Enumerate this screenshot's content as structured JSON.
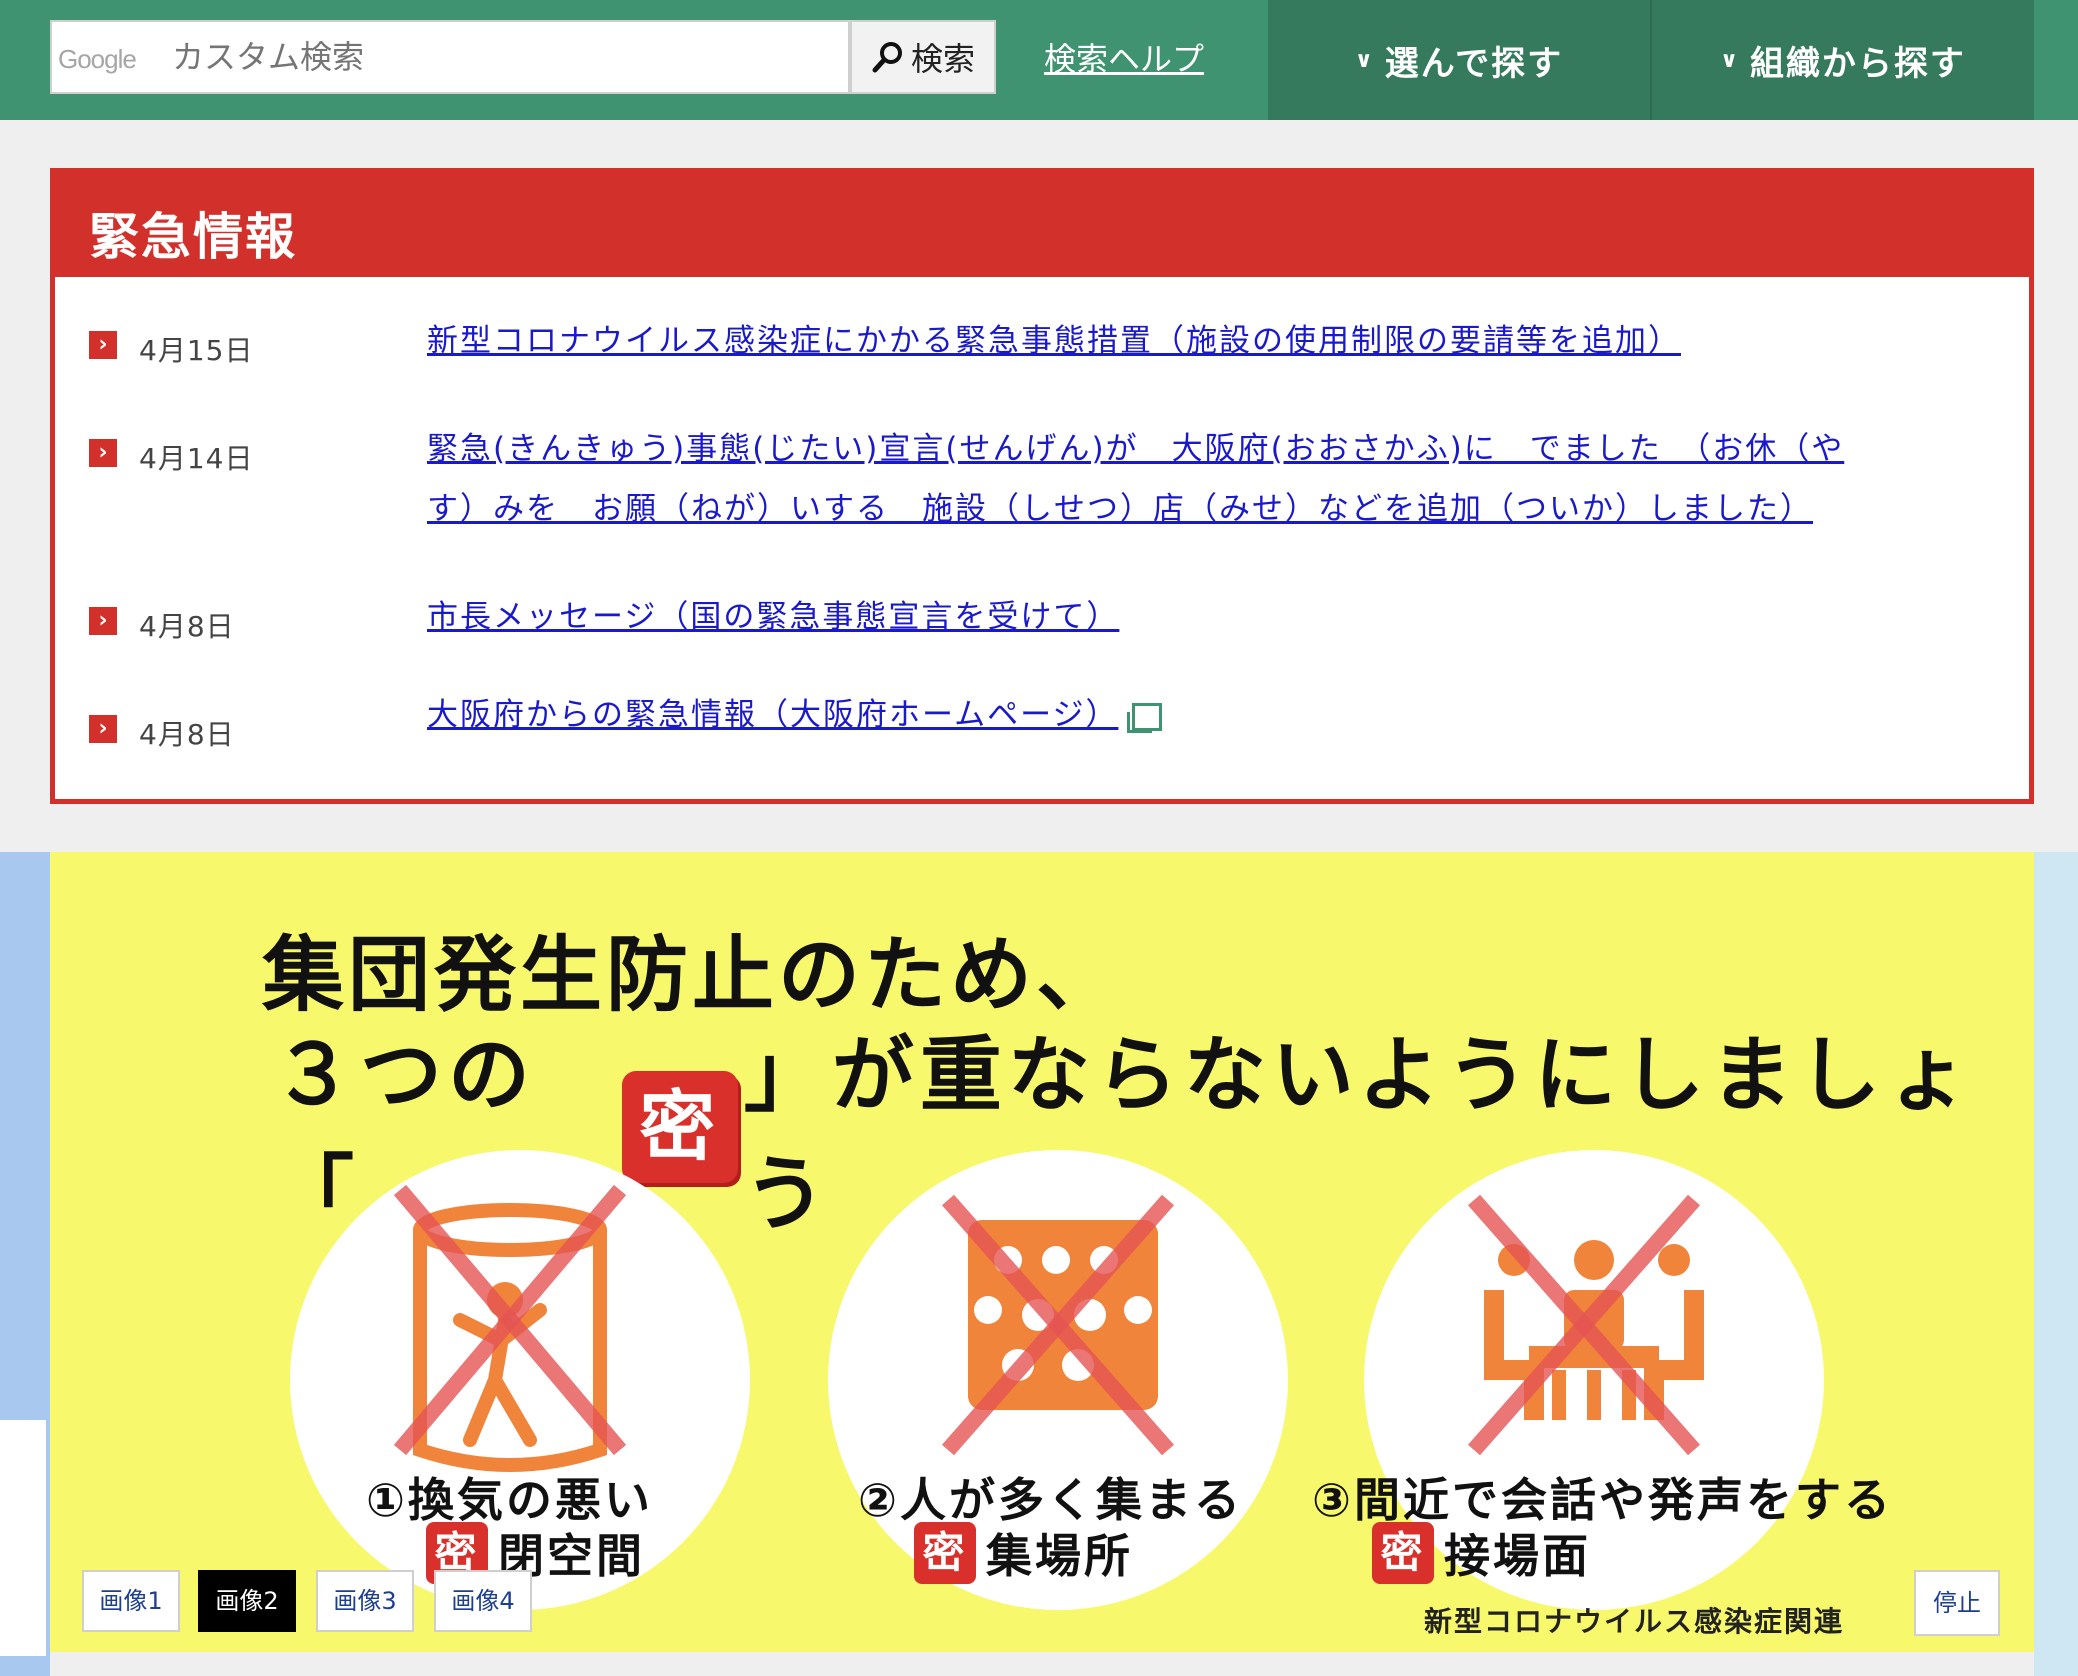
{
  "header": {
    "search_brand": "Google",
    "search_placeholder": "カスタム検索",
    "search_button": "検索",
    "search_help": "検索ヘルプ",
    "nav": [
      {
        "label": "選んで探す"
      },
      {
        "label": "組織から探す"
      }
    ]
  },
  "emergency": {
    "title": "緊急情報",
    "items": [
      {
        "date": "4月15日",
        "text": "新型コロナウイルス感染症にかかる緊急事態措置（施設の使用制限の要請等を追加）"
      },
      {
        "date": "4月14日",
        "text_line1": "緊急(きんきゅう)事態(じたい)宣言(せんげん)が　大阪府(おおさかふ)に　でました　（お休（や",
        "text_line2": "す）みを　お願（ねが）いする　施設（しせつ）店（みせ）などを追加（ついか）しました）"
      },
      {
        "date": "4月8日",
        "text": "市長メッセージ（国の緊急事態宣言を受けて）"
      },
      {
        "date": "4月8日",
        "text": "大阪府からの緊急情報（大阪府ホームページ）"
      }
    ]
  },
  "banner": {
    "title_line1": "集団発生防止のため、",
    "title_prefix": "３つの「",
    "mitsu": "密",
    "title_suffix": "」が重ならないようにしましょう",
    "items": [
      {
        "line1": "①換気の悪い",
        "line2": "閉空間"
      },
      {
        "line1": "②人が多く集まる",
        "line2": "集場所"
      },
      {
        "line1": "③間近で会話や発声をする",
        "line2": "接場面"
      }
    ],
    "footnote": "新型コロナウイルス感染症関連",
    "slide_buttons": [
      "画像1",
      "画像2",
      "画像3",
      "画像4"
    ],
    "active_slide": 2,
    "stop_button": "停止"
  },
  "colors": {
    "header_green": "#3f9370",
    "emergency_red": "#d2302a",
    "banner_yellow": "#f7f86b",
    "icon_orange": "#f0843a",
    "link_blue": "#1a1acb"
  }
}
